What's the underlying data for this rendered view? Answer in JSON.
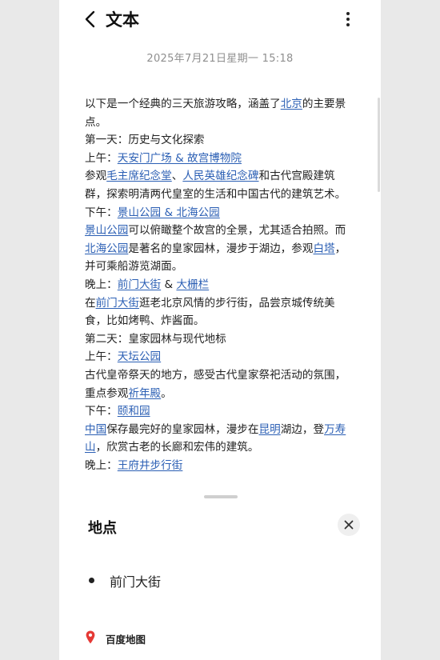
{
  "header": {
    "title": "文本",
    "back_icon": "chevron-left-icon",
    "menu_icon": "more-vertical-icon"
  },
  "timestamp": "2025年7月21日星期一 15:18",
  "note": {
    "l1_a": "以下是一个经典的三天旅游攻略，涵盖了",
    "l1_link": "北京",
    "l1_b": "的主要景点。",
    "l2": "第一天：历史与文化探索",
    "l3_a": "上午：",
    "l3_link": "天安门广场 & 故宫博物院",
    "l4_a": "参观",
    "l4_link1": "毛主席纪念堂",
    "l4_b": "、",
    "l4_link2": "人民英雄纪念碑",
    "l4_c": "和古代宫殿建筑群，探索明清两代皇室的生活和中国古代的建筑艺术。",
    "l5_a": "下午：",
    "l5_link": "景山公园 & 北海公园",
    "l6_link1": "景山公园",
    "l6_a": "可以俯瞰整个故宫的全景，尤其适合拍照。而",
    "l6_link2": "北海公园",
    "l6_b": "是著名的皇家园林，漫步于湖边，参观",
    "l6_link3": "白塔",
    "l6_c": "，并可乘船游览湖面。",
    "l7_a": "晚上：",
    "l7_link1": "前门大街",
    "l7_b": " & ",
    "l7_link2": "大栅栏",
    "l8_a": "在",
    "l8_link": "前门大街",
    "l8_b": "逛老北京风情的步行街，品尝京城传统美食，比如烤鸭、炸酱面。",
    "l9": "第二天：皇家园林与现代地标",
    "l10_a": "上午：",
    "l10_link": "天坛公园",
    "l11_a": "古代皇帝祭天的地方，感受古代皇家祭祀活动的氛围，重点参观",
    "l11_link": "祈年殿",
    "l11_b": "。",
    "l12_a": "下午：",
    "l12_link": "颐和园",
    "l13_link1": "中国",
    "l13_a": "保存最完好的皇家园林，漫步在",
    "l13_link2": "昆明",
    "l13_b": "湖边，登",
    "l13_link3": "万寿山",
    "l13_c": "，欣赏古老的长廊和宏伟的建筑。",
    "l14_a": "晚上：",
    "l14_link": "王府井步行街"
  },
  "sheet": {
    "title": "地点",
    "close_icon": "close-icon",
    "place": "前门大街",
    "map_icon": "map-pin-icon",
    "map_app": "百度地图"
  },
  "colors": {
    "link": "#2b5fb4",
    "map_pin": "#e53935",
    "timestamp": "#8f8f8f"
  }
}
